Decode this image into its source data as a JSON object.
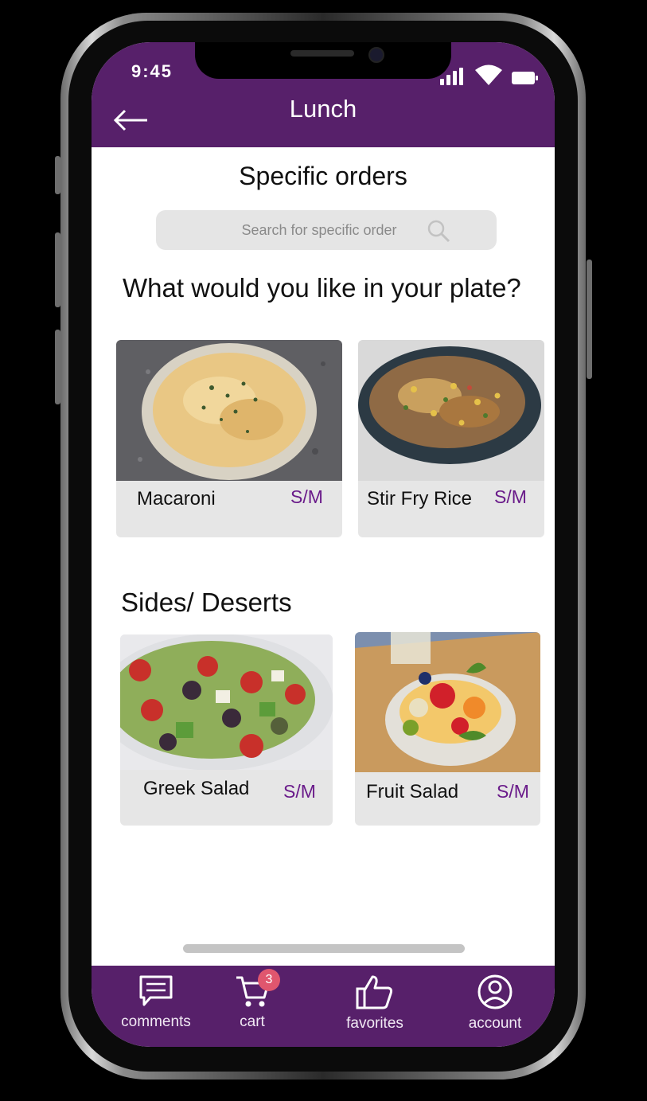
{
  "status_bar": {
    "time": "9:45"
  },
  "header": {
    "title": "Lunch"
  },
  "main": {
    "section_title": "Specific orders",
    "search": {
      "placeholder": "Search for specific order"
    },
    "plate_question": "What would you like in your plate?",
    "plate_items": [
      {
        "name": "Macaroni",
        "size": "S/M"
      },
      {
        "name": "Stir Fry Rice",
        "size": "S/M"
      }
    ],
    "sides_title": "Sides/ Deserts",
    "side_items": [
      {
        "name": "Greek Salad",
        "size": "S/M"
      },
      {
        "name": "Fruit Salad",
        "size": "S/M"
      }
    ]
  },
  "bottom_nav": {
    "items": [
      {
        "label": "comments",
        "icon": "comment-icon"
      },
      {
        "label": "cart",
        "icon": "cart-icon"
      },
      {
        "label": "favorites",
        "icon": "thumbs-up-icon"
      },
      {
        "label": "account",
        "icon": "user-circle-icon"
      }
    ],
    "cart_count": "3"
  },
  "colors": {
    "brand": "#57206a",
    "size_label": "#6a1b8a",
    "card_bg": "#e6e6e6",
    "badge": "#e0566e"
  }
}
